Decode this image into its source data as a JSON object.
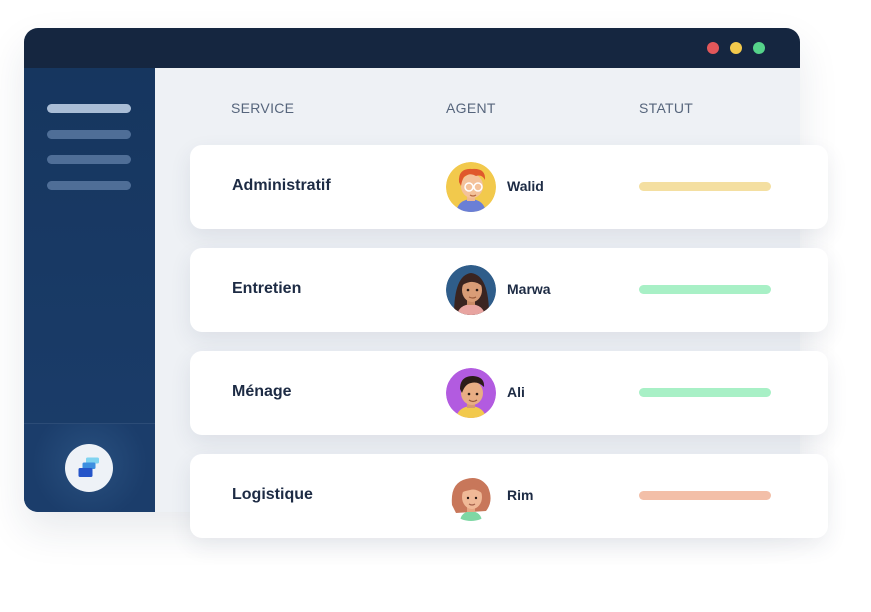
{
  "window": {
    "controls": [
      {
        "name": "close",
        "color": "#e2575a"
      },
      {
        "name": "minimize",
        "color": "#f2c94c"
      },
      {
        "name": "maximize",
        "color": "#55d38a"
      }
    ]
  },
  "sidebar": {
    "menu_lines": 4,
    "logo_icon": "stacked-cards-logo-icon"
  },
  "table": {
    "headers": {
      "service": "SERVICE",
      "agent": "AGENT",
      "statut": "STATUT"
    },
    "rows": [
      {
        "service": "Administratif",
        "agent": "Walid",
        "avatar": "avatar-walid",
        "status_color": "#f4dfa1"
      },
      {
        "service": "Entretien",
        "agent": "Marwa",
        "avatar": "avatar-marwa",
        "status_color": "#a8f0c6"
      },
      {
        "service": "Ménage",
        "agent": "Ali",
        "avatar": "avatar-ali",
        "status_color": "#a8f0c6"
      },
      {
        "service": "Logistique",
        "agent": "Rim",
        "avatar": "avatar-rim",
        "status_color": "#f3bfa8"
      }
    ]
  }
}
